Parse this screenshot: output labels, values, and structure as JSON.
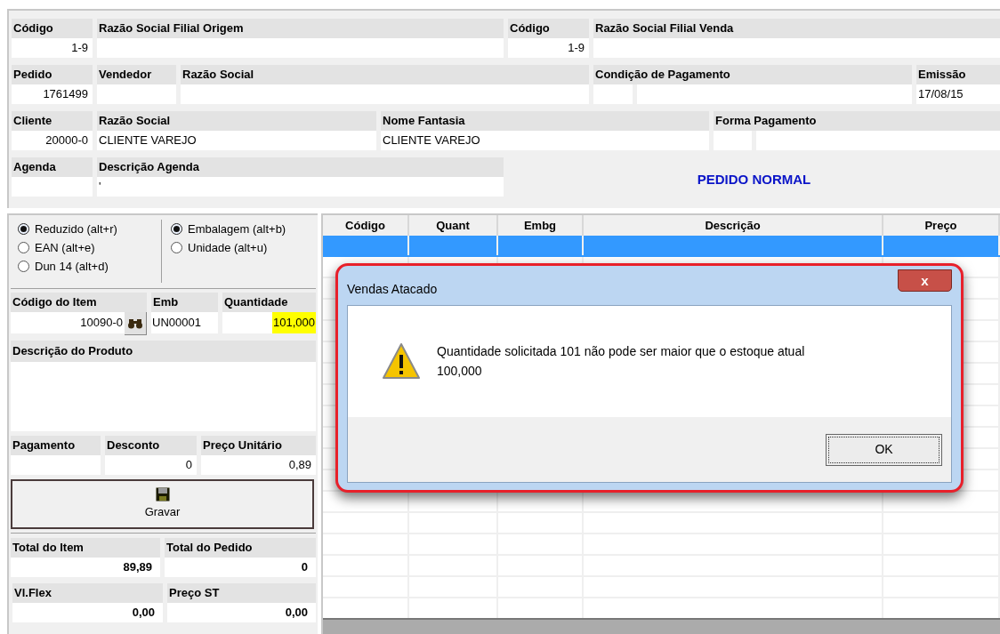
{
  "header": {
    "rows": [
      [
        {
          "label": "Código",
          "value": "1-9"
        },
        {
          "label": "Razão Social Filial Origem"
        },
        {
          "label": "Código",
          "value": "1-9"
        },
        {
          "label": "Razão Social Filial Venda"
        }
      ],
      [
        {
          "label": "Pedido",
          "value": "1761499"
        },
        {
          "label": "Vendedor"
        },
        {
          "label": "Razão Social"
        },
        {
          "label": "Condição de Pagamento"
        },
        {
          "label": "Emissão",
          "value": "17/08/15"
        }
      ],
      [
        {
          "label": "Cliente",
          "value": "20000-0"
        },
        {
          "label": "Razão Social",
          "value": "CLIENTE VAREJO"
        },
        {
          "label": "Nome Fantasia",
          "value": "CLIENTE VAREJO"
        },
        {
          "label": "Forma Pagamento"
        }
      ],
      [
        {
          "label": "Agenda"
        },
        {
          "label": "Descrição Agenda",
          "value": "'"
        }
      ]
    ],
    "order_type": "PEDIDO NORMAL"
  },
  "code_type": [
    {
      "label": "Reduzido (alt+r)",
      "selected": true
    },
    {
      "label": "EAN (alt+e)",
      "selected": false
    },
    {
      "label": "Dun 14 (alt+d)",
      "selected": false
    }
  ],
  "unit_type": [
    {
      "label": "Embalagem (alt+b)",
      "selected": true
    },
    {
      "label": "Unidade (alt+u)",
      "selected": false
    }
  ],
  "item": {
    "code_label": "Código do Item",
    "code": "10090-0",
    "emb_label": "Emb",
    "emb": "UN00001",
    "qty_label": "Quantidade",
    "qty": "101,000",
    "qty_highlighted": true,
    "description_label": "Descrição do Produto"
  },
  "pricing": [
    {
      "label": "Pagamento"
    },
    {
      "label": "Desconto",
      "value": "0"
    },
    {
      "label": "Preço Unitário",
      "value": "0,89"
    }
  ],
  "save_button": {
    "label": "Gravar"
  },
  "totals": [
    {
      "label": "Total do Item",
      "value": "89,89"
    },
    {
      "label": "Total do Pedido",
      "value": "0"
    }
  ],
  "extras": [
    {
      "label": "Vl.Flex",
      "value": "0,00"
    },
    {
      "label": "Preço ST",
      "value": "0,00"
    }
  ],
  "grid": {
    "columns": [
      "Código",
      "Quant",
      "Embg",
      "Descrição",
      "Preço"
    ],
    "rows": [
      {
        "selected": true
      }
    ]
  },
  "dialog": {
    "title": "Vendas Atacado",
    "close": "x",
    "message": "Quantidade solicitada 101 não pode ser maior que o estoque atual 100,000",
    "button": "OK"
  }
}
